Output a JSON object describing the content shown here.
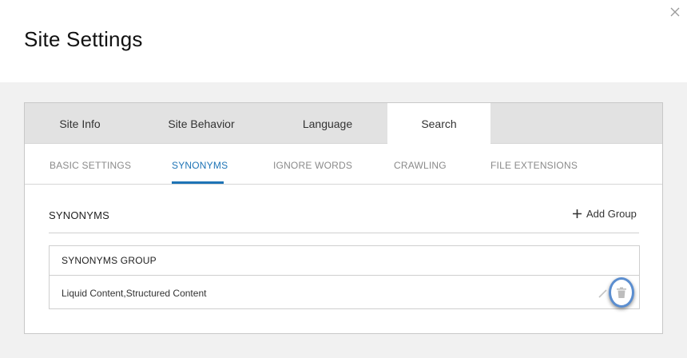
{
  "header": {
    "title": "Site Settings",
    "close_icon": "close-icon"
  },
  "main_tabs": [
    {
      "label": "Site Info",
      "active": false
    },
    {
      "label": "Site Behavior",
      "active": false
    },
    {
      "label": "Language",
      "active": false
    },
    {
      "label": "Search",
      "active": true
    }
  ],
  "sub_tabs": [
    {
      "label": "BASIC SETTINGS",
      "active": false
    },
    {
      "label": "SYNONYMS",
      "active": true
    },
    {
      "label": "IGNORE WORDS",
      "active": false
    },
    {
      "label": "CRAWLING",
      "active": false
    },
    {
      "label": "FILE EXTENSIONS",
      "active": false
    }
  ],
  "synonyms": {
    "title": "SYNONYMS",
    "add_label": "Add Group",
    "table": {
      "column_header": "SYNONYMS GROUP",
      "rows": [
        {
          "value": "Liquid Content,Structured Content"
        }
      ]
    }
  },
  "colors": {
    "accent": "#1e74b6",
    "highlight_ring": "#5b8ed0",
    "tab_bar": "#e2e2e2",
    "page_bg": "#f1f1f1"
  }
}
